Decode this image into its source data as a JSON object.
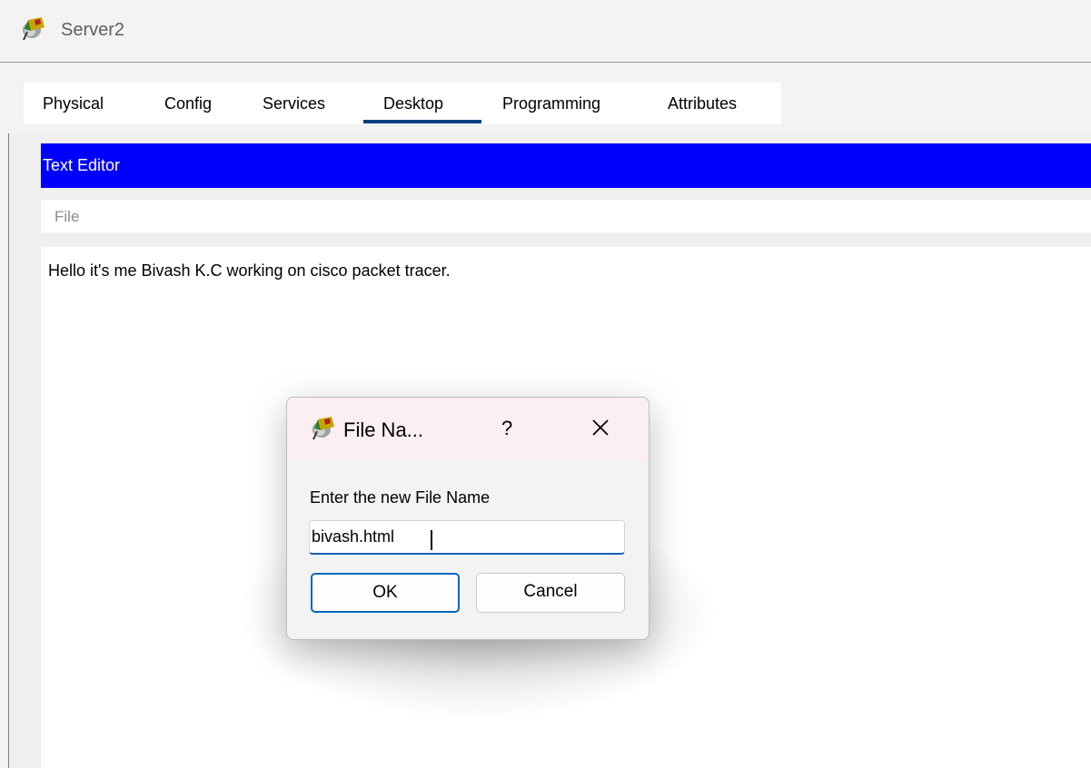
{
  "window": {
    "title": "Server2",
    "icon": "packet-tracer-app-icon"
  },
  "tabs": [
    {
      "label": "Physical"
    },
    {
      "label": "Config"
    },
    {
      "label": "Services"
    },
    {
      "label": "Desktop",
      "active": true
    },
    {
      "label": "Programming"
    },
    {
      "label": "Attributes"
    }
  ],
  "editor": {
    "header": "Text Editor",
    "menu_file": "File",
    "content": "Hello it's me Bivash K.C working on cisco packet tracer."
  },
  "dialog": {
    "title": "File Na...",
    "help": "?",
    "prompt": "Enter the new File Name",
    "input_value": "bivash.html",
    "ok_label": "OK",
    "cancel_label": "Cancel"
  },
  "colors": {
    "header_blue": "#0000ff",
    "tab_underline": "#003f7f",
    "input_focus": "#0a5fb4",
    "ok_border": "#0067c0"
  }
}
